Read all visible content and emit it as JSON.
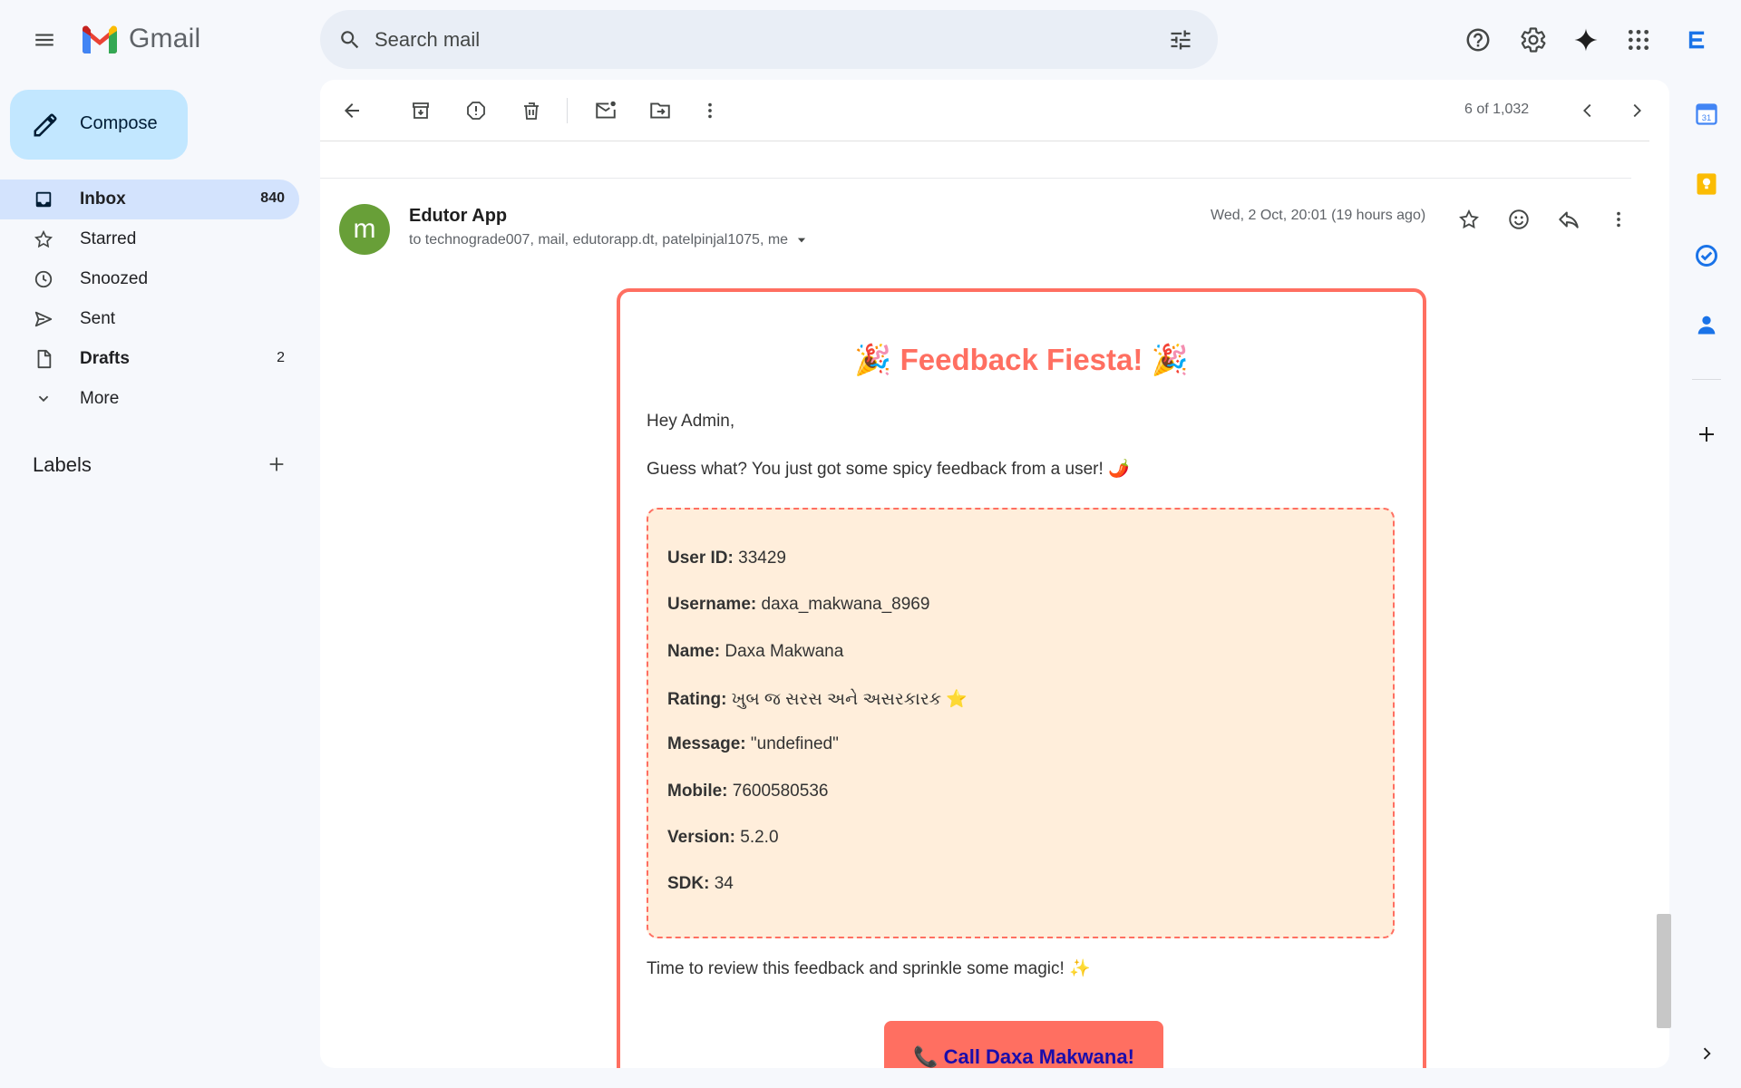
{
  "app": {
    "logo_text": "Gmail"
  },
  "search": {
    "placeholder": "Search mail"
  },
  "compose": {
    "label": "Compose"
  },
  "nav": [
    {
      "label": "Inbox",
      "count": "840"
    },
    {
      "label": "Starred",
      "count": ""
    },
    {
      "label": "Snoozed",
      "count": ""
    },
    {
      "label": "Sent",
      "count": ""
    },
    {
      "label": "Drafts",
      "count": "2"
    },
    {
      "label": "More",
      "count": ""
    }
  ],
  "labels": {
    "heading": "Labels"
  },
  "toolbar": {
    "pager": "6 of 1,032"
  },
  "message": {
    "avatar_letter": "m",
    "sender": "Edutor App",
    "recipients": "to technograde007, mail, edutorapp.dt, patelpinjal1075, me",
    "date": "Wed, 2 Oct, 20:01 (19 hours ago)"
  },
  "email": {
    "title": "🎉 Feedback Fiesta! 🎉",
    "greeting": "Hey Admin,",
    "intro": "Guess what? You just got some spicy feedback from a user! 🌶️",
    "fields": [
      {
        "key": "User ID:",
        "value": "33429"
      },
      {
        "key": "Username:",
        "value": "daxa_makwana_8969"
      },
      {
        "key": "Name:",
        "value": "Daxa Makwana"
      },
      {
        "key": "Rating:",
        "value": "ખુબ જ સરસ અને અસરકારક ⭐"
      },
      {
        "key": "Message:",
        "value": "\"undefined\""
      },
      {
        "key": "Mobile:",
        "value": "7600580536"
      },
      {
        "key": "Version:",
        "value": "5.2.0"
      },
      {
        "key": "SDK:",
        "value": "34"
      }
    ],
    "outro": "Time to review this feedback and sprinkle some magic! ✨",
    "call_button": "📞 Call Daxa Makwana!"
  },
  "colors": {
    "accent": "#ff6f61",
    "field_bg": "#ffeedb",
    "inbox_active": "#d3e3fd",
    "compose_bg": "#c2e7ff"
  }
}
